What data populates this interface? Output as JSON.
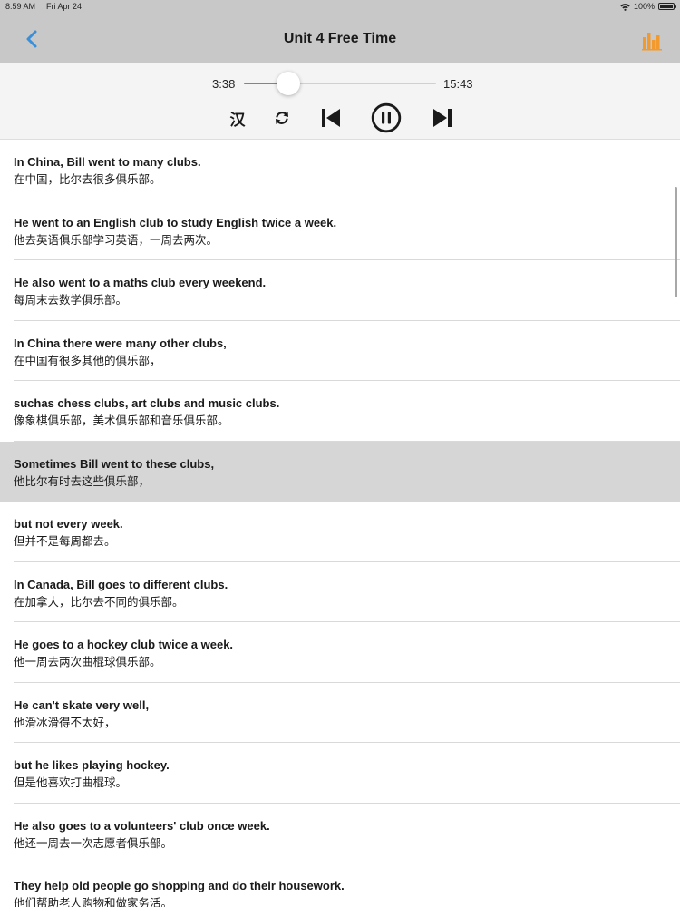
{
  "status_bar": {
    "time": "8:59 AM",
    "date": "Fri Apr 24",
    "battery": "100%"
  },
  "nav": {
    "title": "Unit 4 Free Time",
    "accent_color": "#3a8fd9",
    "equalizer_color": "#f29a2e"
  },
  "player": {
    "elapsed": "3:38",
    "total": "15:43",
    "progress_fraction": 0.231,
    "translation_toggle_label": "汉",
    "state": "playing"
  },
  "sentences": [
    {
      "en": "In China, Bill went to many clubs.",
      "zh": "在中国，比尔去很多俱乐部。",
      "highlighted": false
    },
    {
      "en": "He went to an English club to study English twice a week.",
      "zh": "他去英语俱乐部学习英语，一周去两次。",
      "highlighted": false
    },
    {
      "en": "He also went to a maths club every weekend.",
      "zh": "每周末去数学俱乐部。",
      "highlighted": false
    },
    {
      "en": "In China there were many other clubs,",
      "zh": "在中国有很多其他的俱乐部，",
      "highlighted": false
    },
    {
      "en": "suchas chess clubs, art clubs and music clubs.",
      "zh": "像象棋俱乐部，美术俱乐部和音乐俱乐部。",
      "highlighted": false
    },
    {
      "en": "Sometimes Bill went to these clubs,",
      "zh": "他比尔有时去这些俱乐部，",
      "highlighted": true
    },
    {
      "en": "but not every week.",
      "zh": "但并不是每周都去。",
      "highlighted": false
    },
    {
      "en": "In Canada, Bill goes to different clubs.",
      "zh": "在加拿大，比尔去不同的俱乐部。",
      "highlighted": false
    },
    {
      "en": "He goes to a hockey club twice a week.",
      "zh": "他一周去两次曲棍球俱乐部。",
      "highlighted": false
    },
    {
      "en": "He can't skate very well,",
      "zh": "他滑冰滑得不太好，",
      "highlighted": false
    },
    {
      "en": "but he likes playing hockey.",
      "zh": "但是他喜欢打曲棍球。",
      "highlighted": false
    },
    {
      "en": "He also goes to a volunteers' club once week.",
      "zh": "他还一周去一次志愿者俱乐部。",
      "highlighted": false
    },
    {
      "en": "They help old people go shopping and do their housework.",
      "zh": "他们帮助老人购物和做家务活。",
      "highlighted": false
    }
  ]
}
